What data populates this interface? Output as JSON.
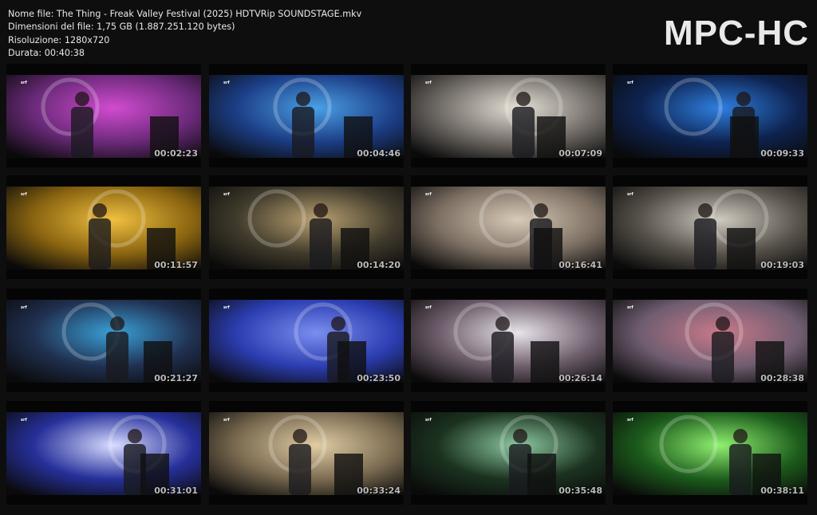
{
  "info": {
    "filename": "Nome file: The Thing - Freak Valley Festival (2025) HDTVRip SOUNDSTAGE.mkv",
    "filesize": "Dimensioni del file: 1,75 GB (1.887.251.120 bytes)",
    "resolution": "Risoluzione: 1280x720",
    "duration": "Durata: 00:40:38"
  },
  "brand": "MPC-HC",
  "thumbnails": [
    {
      "time": "00:02:23",
      "bg": "#6b2a7a",
      "accent": "#d24bd0"
    },
    {
      "time": "00:04:46",
      "bg": "#1c3e86",
      "accent": "#4aa0e6"
    },
    {
      "time": "00:07:09",
      "bg": "#6f6a65",
      "accent": "#e6e1d6"
    },
    {
      "time": "00:09:33",
      "bg": "#0e2350",
      "accent": "#2f7fe0"
    },
    {
      "time": "00:11:57",
      "bg": "#8a6410",
      "accent": "#f0c040"
    },
    {
      "time": "00:14:20",
      "bg": "#3f3a2b",
      "accent": "#b9a070"
    },
    {
      "time": "00:16:41",
      "bg": "#7d7063",
      "accent": "#d8cab8"
    },
    {
      "time": "00:19:03",
      "bg": "#57524a",
      "accent": "#cfcac0"
    },
    {
      "time": "00:21:27",
      "bg": "#203050",
      "accent": "#3aa0d8"
    },
    {
      "time": "00:23:50",
      "bg": "#2b3db0",
      "accent": "#7a8ef0"
    },
    {
      "time": "00:26:14",
      "bg": "#6c5c6a",
      "accent": "#e8e4ea"
    },
    {
      "time": "00:28:38",
      "bg": "#6f5d70",
      "accent": "#c9798a"
    },
    {
      "time": "00:31:01",
      "bg": "#26309a",
      "accent": "#d8dcff"
    },
    {
      "time": "00:33:24",
      "bg": "#7a6a50",
      "accent": "#e0cda4"
    },
    {
      "time": "00:35:48",
      "bg": "#1b3320",
      "accent": "#8cc8a0"
    },
    {
      "time": "00:38:11",
      "bg": "#1c5c1c",
      "accent": "#90f070"
    }
  ],
  "overlay_logo": "srf"
}
